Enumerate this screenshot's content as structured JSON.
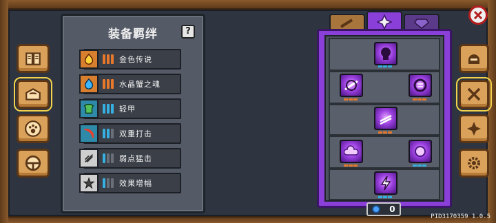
{
  "panel": {
    "title": "装备羁绊",
    "help_label": "?",
    "rows": [
      {
        "label": "金色传说",
        "icon": "fire-orb-icon",
        "icon_bg": "#d77f2e",
        "bar_color": "#e8782a",
        "active_bars": 3
      },
      {
        "label": "水晶蟹之魂",
        "icon": "water-orb-icon",
        "icon_bg": "#d77f2e",
        "bar_color": "#e8782a",
        "active_bars": 3
      },
      {
        "label": "轻甲",
        "icon": "light-armor-icon",
        "icon_bg": "#2e8aa8",
        "bar_color": "#35b0e0",
        "active_bars": 3
      },
      {
        "label": "双重打击",
        "icon": "double-strike-icon",
        "icon_bg": "#2e8aa8",
        "bar_color": "#35b0e0",
        "active_bars": 2
      },
      {
        "label": "弱点猛击",
        "icon": "weak-point-icon",
        "icon_bg": "#cfcfcf",
        "bar_color": "#35b0e0",
        "active_bars": 1
      },
      {
        "label": "效果增幅",
        "icon": "effect-amp-icon",
        "icon_bg": "#cfcfcf",
        "bar_color": "#35b0e0",
        "active_bars": 1
      }
    ]
  },
  "counter": {
    "value": "0"
  },
  "version": "PID3170359 1.0.5",
  "colors": {
    "accent_purple": "#8b3fd9",
    "wood": "#d9a15a"
  }
}
